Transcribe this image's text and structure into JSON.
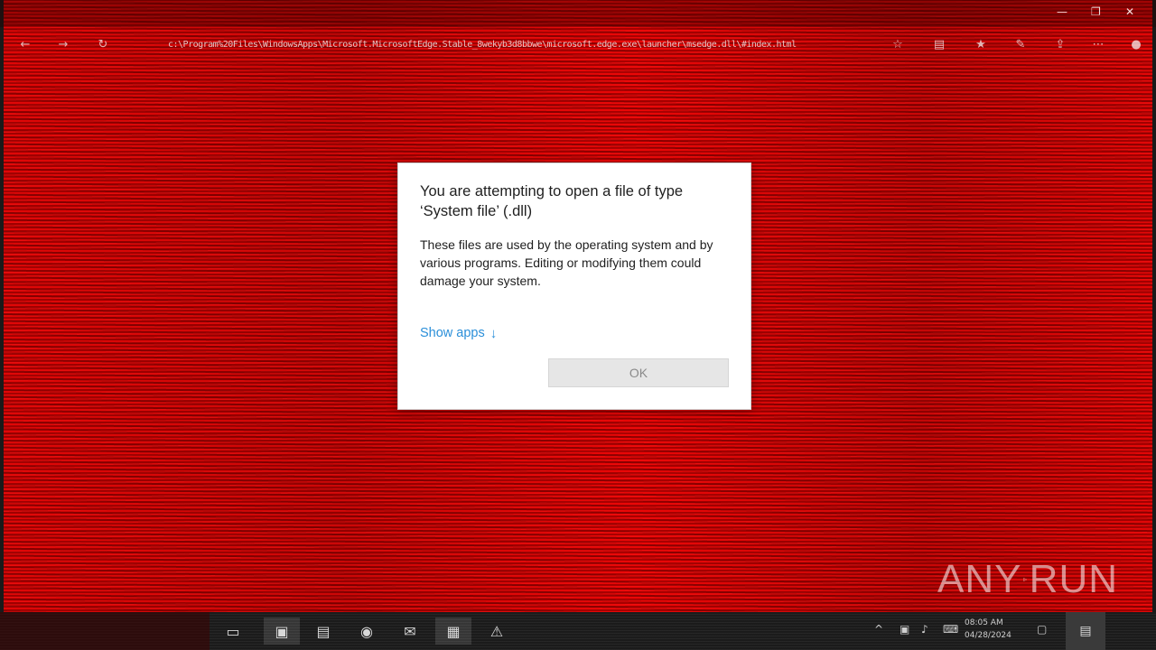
{
  "window": {
    "controls": [
      "—",
      "❐",
      "✕"
    ]
  },
  "address": {
    "text": "c:\\Program%20Files\\WindowsApps\\Microsoft.MicrosoftEdge.Stable_8wekyb3d8bbwe\\microsoft.edge.exe\\launcher\\msedge.dll\\#index.html"
  },
  "dialog": {
    "title": "You are attempting to open a file of type ‘System file’ (.dll)",
    "body": "These files are used by the operating system and by various programs. Editing or modifying them could damage your system.",
    "show_apps_label": "Show apps",
    "show_apps_arrow": "↓",
    "ok_label": "OK"
  },
  "taskbar": {
    "clock_line1": "08:05 AM",
    "clock_line2": "04/28/2024"
  },
  "watermark": {
    "left": "ANY",
    "right": "RUN"
  },
  "colors": {
    "desktop_red": "#c80000",
    "link_blue": "#2b8fd9",
    "button_grey": "#e6e6e6",
    "taskbar": "#1b1b1b"
  }
}
